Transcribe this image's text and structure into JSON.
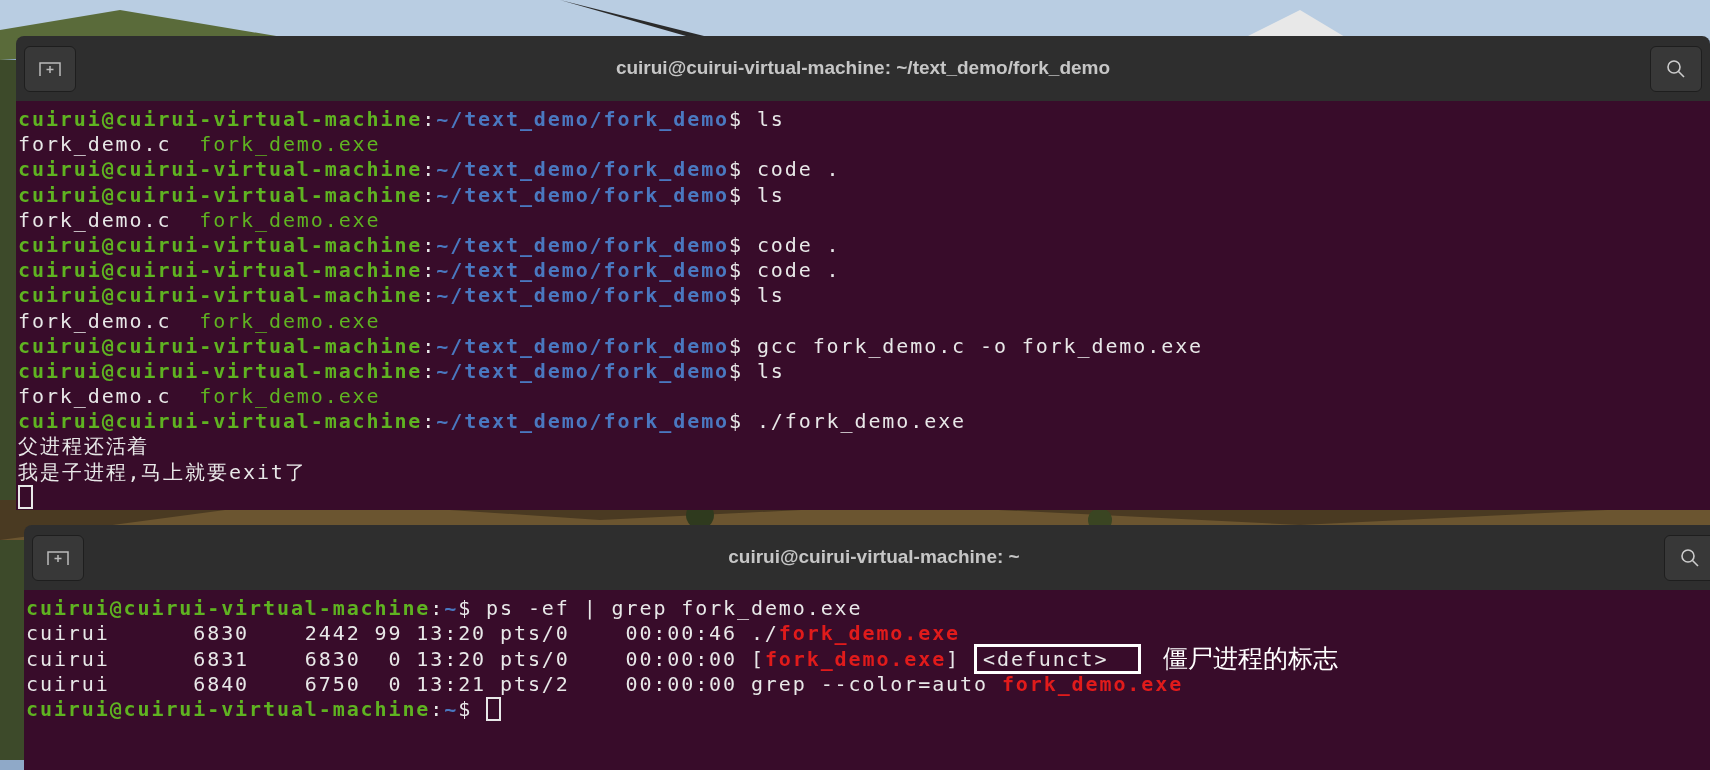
{
  "terminals": [
    {
      "title": "cuirui@cuirui-virtual-machine: ~/text_demo/fork_demo",
      "lines": [
        {
          "segments": [
            {
              "kind": "user",
              "text": "cuirui@cuirui-virtual-machine"
            },
            {
              "kind": "plain",
              "text": ":"
            },
            {
              "kind": "path",
              "text": "~/text_demo/fork_demo"
            },
            {
              "kind": "plain",
              "text": "$ ls"
            }
          ]
        },
        {
          "segments": [
            {
              "kind": "plain",
              "text": "fork_demo.c  "
            },
            {
              "kind": "exe",
              "text": "fork_demo.exe"
            }
          ]
        },
        {
          "segments": [
            {
              "kind": "user",
              "text": "cuirui@cuirui-virtual-machine"
            },
            {
              "kind": "plain",
              "text": ":"
            },
            {
              "kind": "path",
              "text": "~/text_demo/fork_demo"
            },
            {
              "kind": "plain",
              "text": "$ code ."
            }
          ]
        },
        {
          "segments": [
            {
              "kind": "user",
              "text": "cuirui@cuirui-virtual-machine"
            },
            {
              "kind": "plain",
              "text": ":"
            },
            {
              "kind": "path",
              "text": "~/text_demo/fork_demo"
            },
            {
              "kind": "plain",
              "text": "$ ls"
            }
          ]
        },
        {
          "segments": [
            {
              "kind": "plain",
              "text": "fork_demo.c  "
            },
            {
              "kind": "exe",
              "text": "fork_demo.exe"
            }
          ]
        },
        {
          "segments": [
            {
              "kind": "user",
              "text": "cuirui@cuirui-virtual-machine"
            },
            {
              "kind": "plain",
              "text": ":"
            },
            {
              "kind": "path",
              "text": "~/text_demo/fork_demo"
            },
            {
              "kind": "plain",
              "text": "$ code ."
            }
          ]
        },
        {
          "segments": [
            {
              "kind": "user",
              "text": "cuirui@cuirui-virtual-machine"
            },
            {
              "kind": "plain",
              "text": ":"
            },
            {
              "kind": "path",
              "text": "~/text_demo/fork_demo"
            },
            {
              "kind": "plain",
              "text": "$ code ."
            }
          ]
        },
        {
          "segments": [
            {
              "kind": "user",
              "text": "cuirui@cuirui-virtual-machine"
            },
            {
              "kind": "plain",
              "text": ":"
            },
            {
              "kind": "path",
              "text": "~/text_demo/fork_demo"
            },
            {
              "kind": "plain",
              "text": "$ ls"
            }
          ]
        },
        {
          "segments": [
            {
              "kind": "plain",
              "text": "fork_demo.c  "
            },
            {
              "kind": "exe",
              "text": "fork_demo.exe"
            }
          ]
        },
        {
          "segments": [
            {
              "kind": "user",
              "text": "cuirui@cuirui-virtual-machine"
            },
            {
              "kind": "plain",
              "text": ":"
            },
            {
              "kind": "path",
              "text": "~/text_demo/fork_demo"
            },
            {
              "kind": "plain",
              "text": "$ gcc fork_demo.c -o fork_demo.exe"
            }
          ]
        },
        {
          "segments": [
            {
              "kind": "user",
              "text": "cuirui@cuirui-virtual-machine"
            },
            {
              "kind": "plain",
              "text": ":"
            },
            {
              "kind": "path",
              "text": "~/text_demo/fork_demo"
            },
            {
              "kind": "plain",
              "text": "$ ls"
            }
          ]
        },
        {
          "segments": [
            {
              "kind": "plain",
              "text": "fork_demo.c  "
            },
            {
              "kind": "exe",
              "text": "fork_demo.exe"
            }
          ]
        },
        {
          "segments": [
            {
              "kind": "user",
              "text": "cuirui@cuirui-virtual-machine"
            },
            {
              "kind": "plain",
              "text": ":"
            },
            {
              "kind": "path",
              "text": "~/text_demo/fork_demo"
            },
            {
              "kind": "plain",
              "text": "$ ./fork_demo.exe"
            }
          ]
        },
        {
          "segments": [
            {
              "kind": "plain",
              "text": "父进程还活着"
            }
          ]
        },
        {
          "segments": [
            {
              "kind": "plain",
              "text": "我是子进程,马上就要exit了"
            }
          ]
        },
        {
          "cursor": true
        }
      ]
    },
    {
      "title": "cuirui@cuirui-virtual-machine: ~",
      "lines": [
        {
          "segments": [
            {
              "kind": "user",
              "text": "cuirui@cuirui-virtual-machine"
            },
            {
              "kind": "plain",
              "text": ":"
            },
            {
              "kind": "path",
              "text": "~"
            },
            {
              "kind": "plain",
              "text": "$ ps -ef | grep fork_demo.exe"
            }
          ]
        },
        {
          "segments": [
            {
              "kind": "plain",
              "text": "cuirui      6830    2442 99 13:20 pts/0    00:00:46 ./"
            },
            {
              "kind": "match",
              "text": "fork_demo.exe"
            }
          ]
        },
        {
          "segments": [
            {
              "kind": "plain",
              "text": "cuirui      6831    6830  0 13:20 pts/0    00:00:00 ["
            },
            {
              "kind": "match",
              "text": "fork_demo.exe"
            },
            {
              "kind": "plain",
              "text": "] "
            },
            {
              "kind": "boxed",
              "text": "<defunct>"
            }
          ],
          "annotation": "僵尸进程的标志"
        },
        {
          "segments": [
            {
              "kind": "plain",
              "text": "cuirui      6840    6750  0 13:21 pts/2    00:00:00 grep --color=auto "
            },
            {
              "kind": "match",
              "text": "fork_demo.exe"
            }
          ]
        },
        {
          "segments": [
            {
              "kind": "user",
              "text": "cuirui@cuirui-virtual-machine"
            },
            {
              "kind": "plain",
              "text": ":"
            },
            {
              "kind": "path",
              "text": "~"
            },
            {
              "kind": "plain",
              "text": "$ "
            }
          ],
          "cursor": true
        }
      ]
    }
  ]
}
